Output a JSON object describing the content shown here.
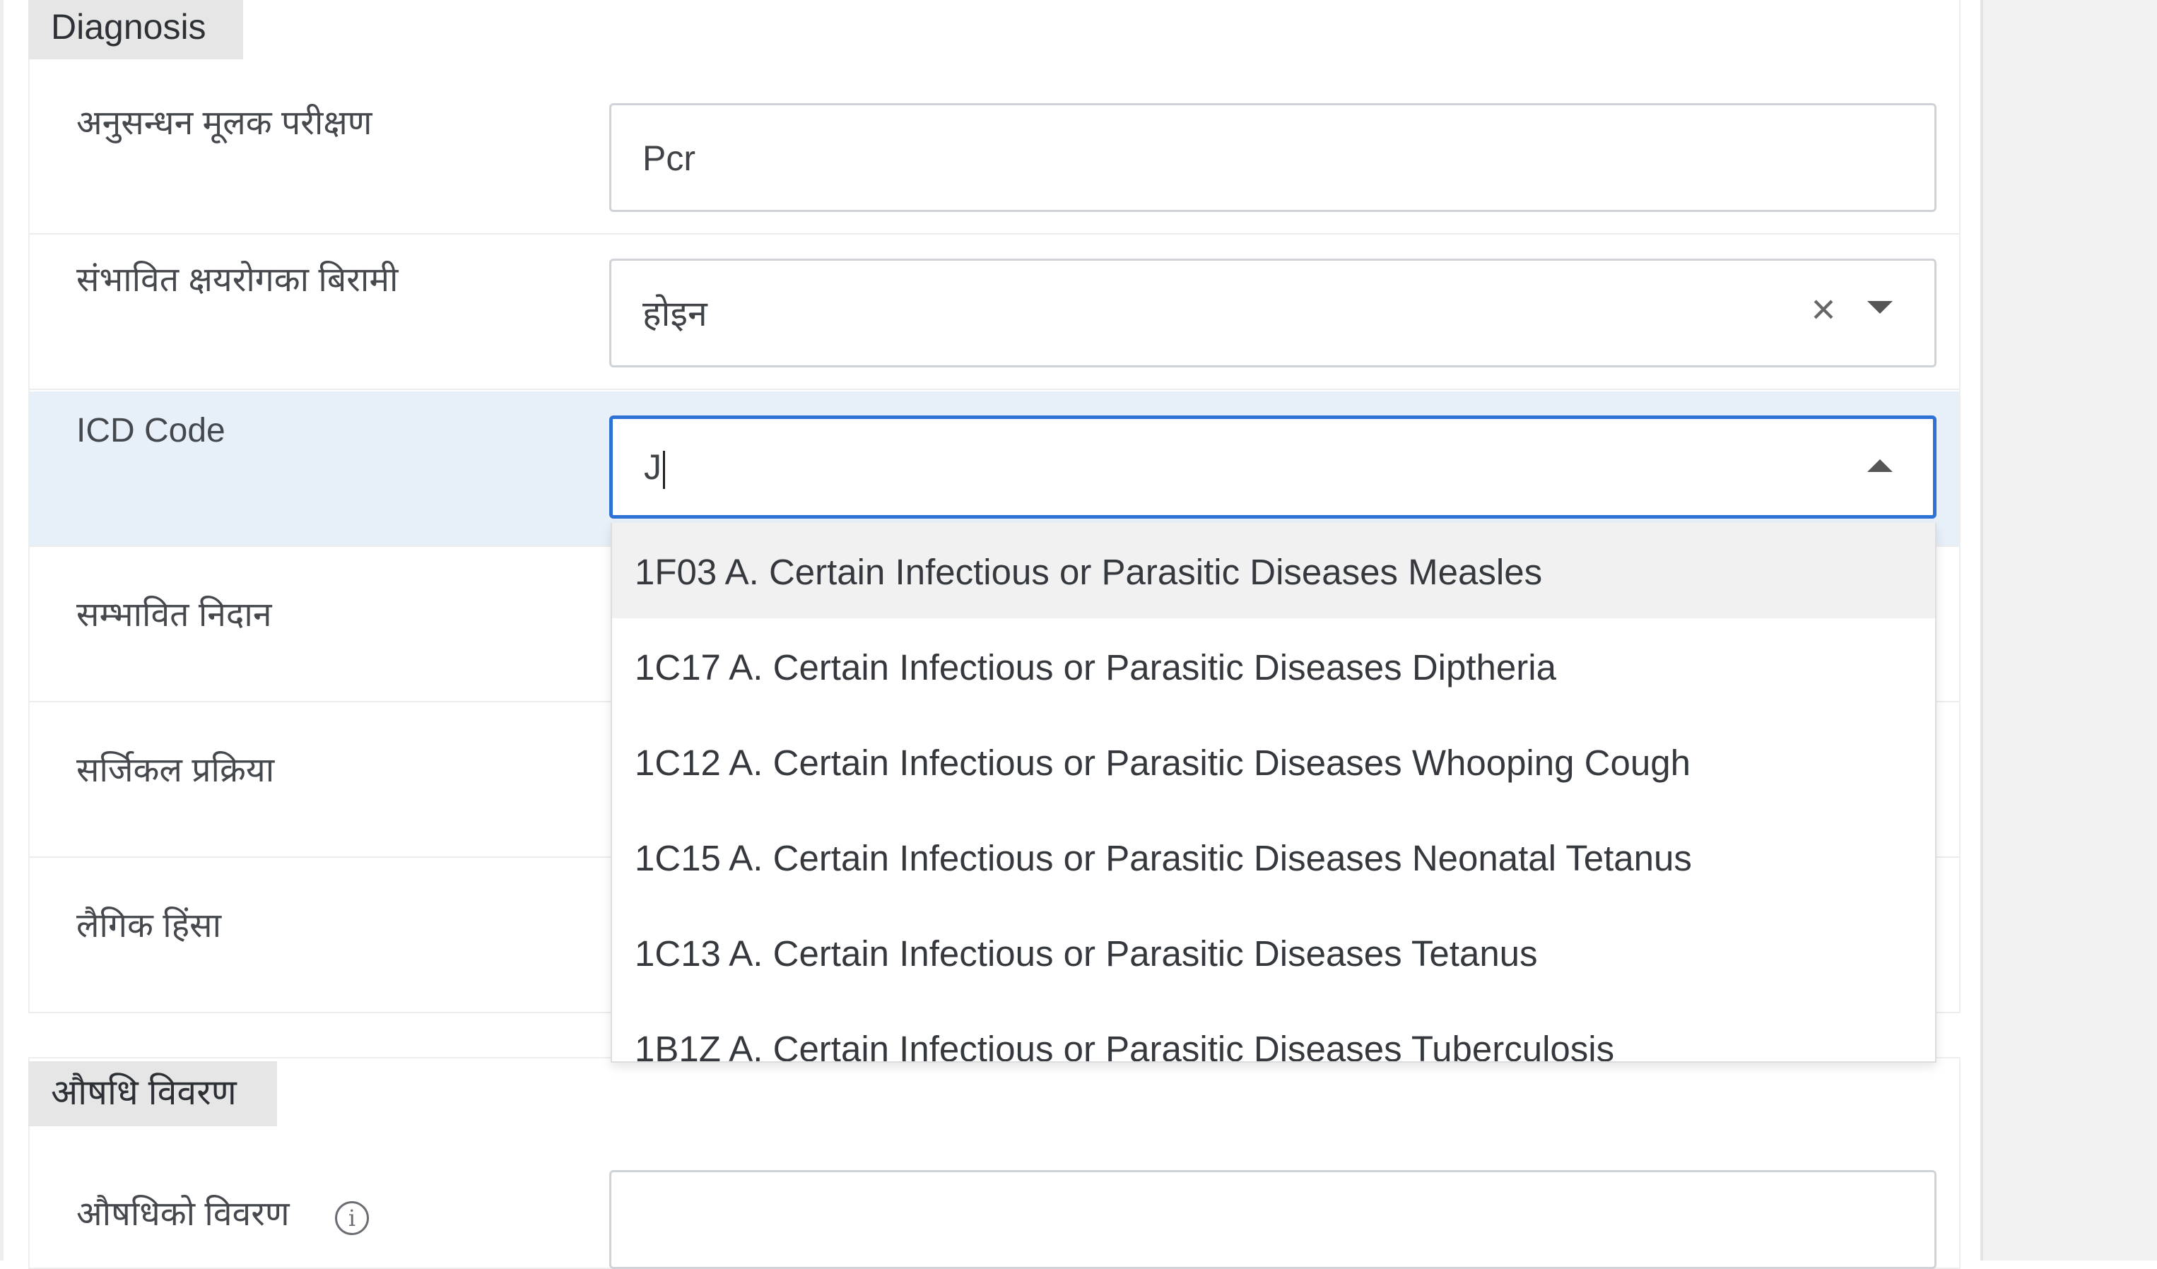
{
  "diagnosis_section": {
    "title": "Diagnosis",
    "fields": {
      "investigation": {
        "label": "अनुसन्धन मूलक परीक्षण",
        "value": "Pcr"
      },
      "tb_suspect": {
        "label": "संभावित क्षयरोगका बिरामी",
        "value": "होइन"
      },
      "icd_code": {
        "label": "ICD Code",
        "value": "J",
        "options": [
          "1F03 A. Certain Infectious or Parasitic Diseases Measles",
          "1C17 A. Certain Infectious or Parasitic Diseases Diptheria",
          "1C12 A. Certain Infectious or Parasitic Diseases Whooping Cough",
          "1C15 A. Certain Infectious or Parasitic Diseases Neonatal Tetanus",
          "1C13 A. Certain Infectious or Parasitic Diseases Tetanus",
          "1B1Z A. Certain Infectious or Parasitic Diseases Tuberculosis"
        ]
      },
      "provisional_diagnosis": {
        "label": "सम्भावित निदान"
      },
      "surgical_procedure": {
        "label": "सर्जिकल प्रक्रिया"
      },
      "gender_violence": {
        "label": "लैगिक हिंसा"
      }
    }
  },
  "medicine_section": {
    "title": "औषधि विवरण",
    "fields": {
      "medicine_details": {
        "label": "औषधिको विवरण",
        "value": ""
      }
    }
  },
  "icons": {
    "clear": "close-icon",
    "collapsed": "chevron-down-icon",
    "expanded": "chevron-up-icon",
    "info": "info-icon"
  },
  "colors": {
    "focus_border": "#2f72d6",
    "focused_row_bg": "#e7eff9",
    "section_title_bg": "#e6e6e6",
    "highlighted_option_bg": "#f1f1f1"
  }
}
